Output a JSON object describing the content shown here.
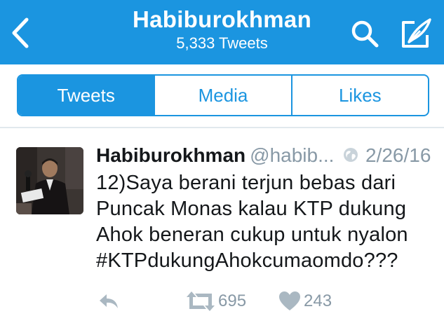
{
  "header": {
    "title": "Habiburokhman",
    "subtitle": "5,333 Tweets",
    "background": "#1b95e0",
    "icons": [
      "back-chevron-icon",
      "search-icon",
      "compose-icon"
    ]
  },
  "tabs": [
    {
      "label": "Tweets",
      "active": true
    },
    {
      "label": "Media",
      "active": false
    },
    {
      "label": "Likes",
      "active": false
    }
  ],
  "tweet": {
    "author_name": "Habiburokhman",
    "handle": "@habib...",
    "date": "2/26/16",
    "text_lines": [
      "12)Saya berani terjun bebas dari",
      "Puncak Monas kalau KTP dukung",
      "Ahok beneran cukup untuk nyalon",
      "#KTPdukungAhokcumaomdo???"
    ],
    "retweets": "695",
    "likes": "243",
    "icons": [
      "avatar",
      "globe-icon",
      "reply-icon",
      "retweet-icon",
      "heart-icon"
    ]
  },
  "colors": {
    "accent": "#1b95e0",
    "text": "#14171a",
    "muted": "#8899a6"
  }
}
